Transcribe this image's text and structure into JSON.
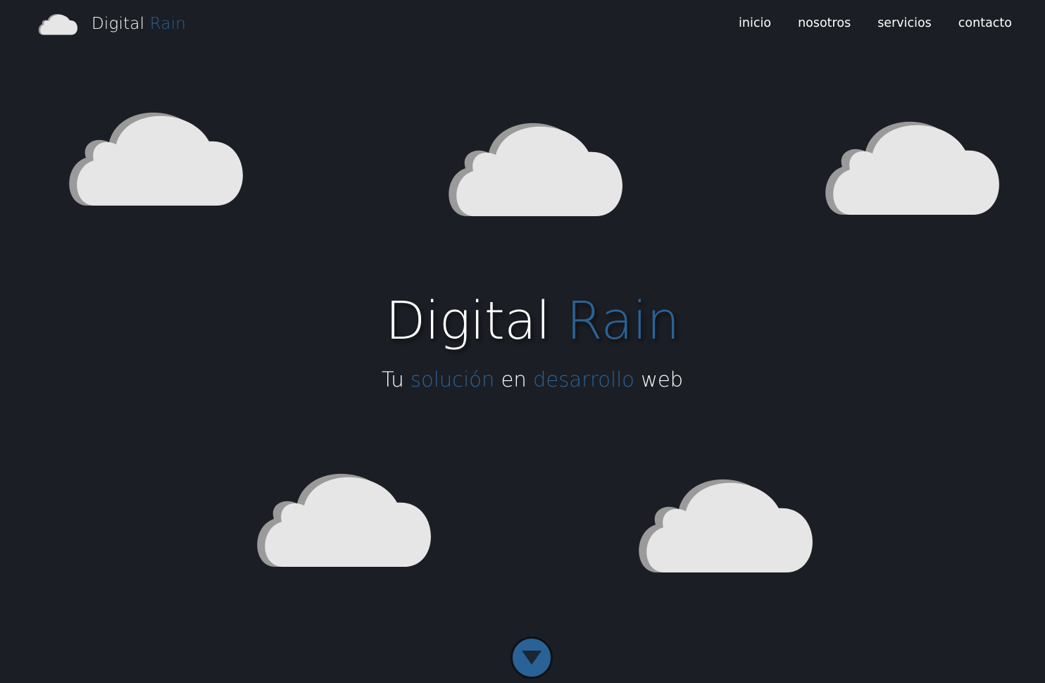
{
  "brand": {
    "name_part1": "Digital",
    "name_part2": "Rain",
    "logo_icon": "cloud-icon"
  },
  "nav": {
    "items": [
      {
        "label": "inicio"
      },
      {
        "label": "nosotros"
      },
      {
        "label": "servicios"
      },
      {
        "label": "contacto"
      }
    ]
  },
  "hero": {
    "title_part1": "Digital",
    "title_part2": "Rain",
    "subtitle": {
      "w1": "Tu",
      "w2": "solución",
      "w3": "en",
      "w4": "desarrollo",
      "w5": "web"
    }
  },
  "decor": {
    "cloud_icon": "cloud-icon",
    "scroll_icon": "arrow-down-icon"
  },
  "colors": {
    "background": "#1b1e24",
    "accent": "#2a6297",
    "text": "#ffffff",
    "cloud": "#e6e6e6",
    "cloud_shadow": "#9a9a9a"
  }
}
